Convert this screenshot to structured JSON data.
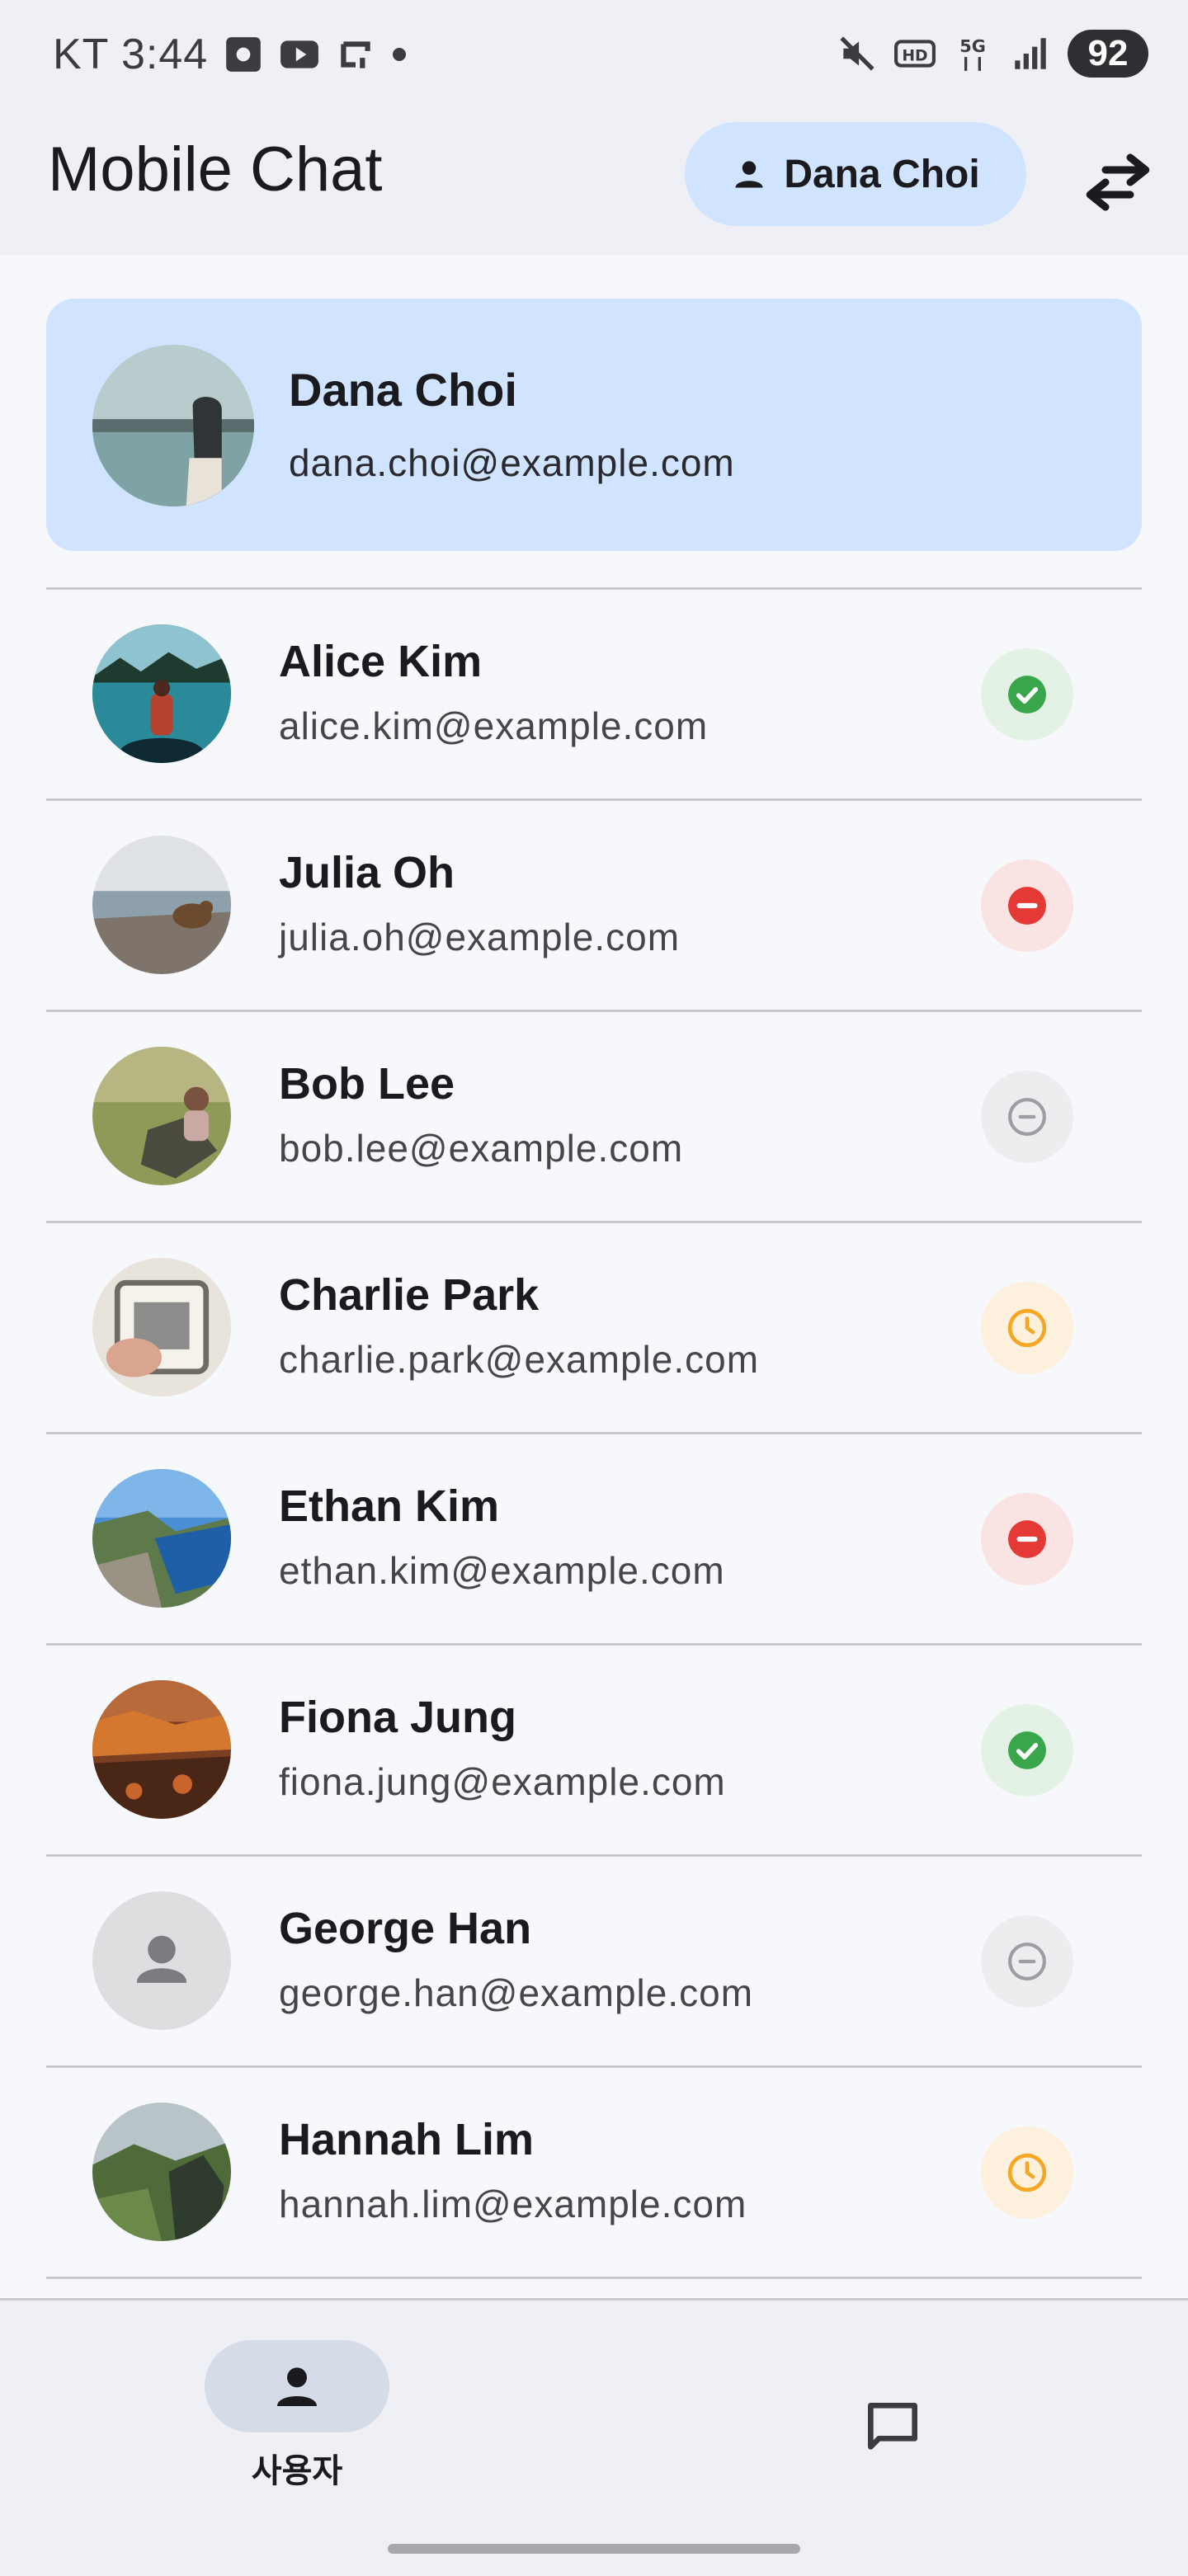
{
  "status_bar": {
    "carrier_time": "KT 3:44",
    "battery": "92",
    "icons": [
      "screenshot-icon",
      "youtube-icon",
      "app-icon",
      "dot-icon",
      "mute-icon",
      "hd-icon",
      "5g-icon",
      "signal-icon"
    ]
  },
  "app_bar": {
    "title": "Mobile Chat",
    "user_chip_label": "Dana Choi",
    "swap_icon": "swap-horiz-icon"
  },
  "profile": {
    "name": "Dana Choi",
    "email": "dana.choi@example.com"
  },
  "contacts": [
    {
      "name": "Alice Kim",
      "email": "alice.kim@example.com",
      "status": "online"
    },
    {
      "name": "Julia Oh",
      "email": "julia.oh@example.com",
      "status": "busy"
    },
    {
      "name": "Bob Lee",
      "email": "bob.lee@example.com",
      "status": "offline"
    },
    {
      "name": "Charlie Park",
      "email": "charlie.park@example.com",
      "status": "away"
    },
    {
      "name": "Ethan Kim",
      "email": "ethan.kim@example.com",
      "status": "busy"
    },
    {
      "name": "Fiona Jung",
      "email": "fiona.jung@example.com",
      "status": "online"
    },
    {
      "name": "George Han",
      "email": "george.han@example.com",
      "status": "offline"
    },
    {
      "name": "Hannah Lim",
      "email": "hannah.lim@example.com",
      "status": "away"
    }
  ],
  "status_colors": {
    "online": "#3aa64c",
    "busy": "#e53935",
    "offline": "#9e9ea2",
    "away": "#f5a623"
  },
  "bottom_nav": {
    "users_label": "사용자",
    "users_icon": "person-icon",
    "chat_icon": "chat-bubble-icon"
  }
}
